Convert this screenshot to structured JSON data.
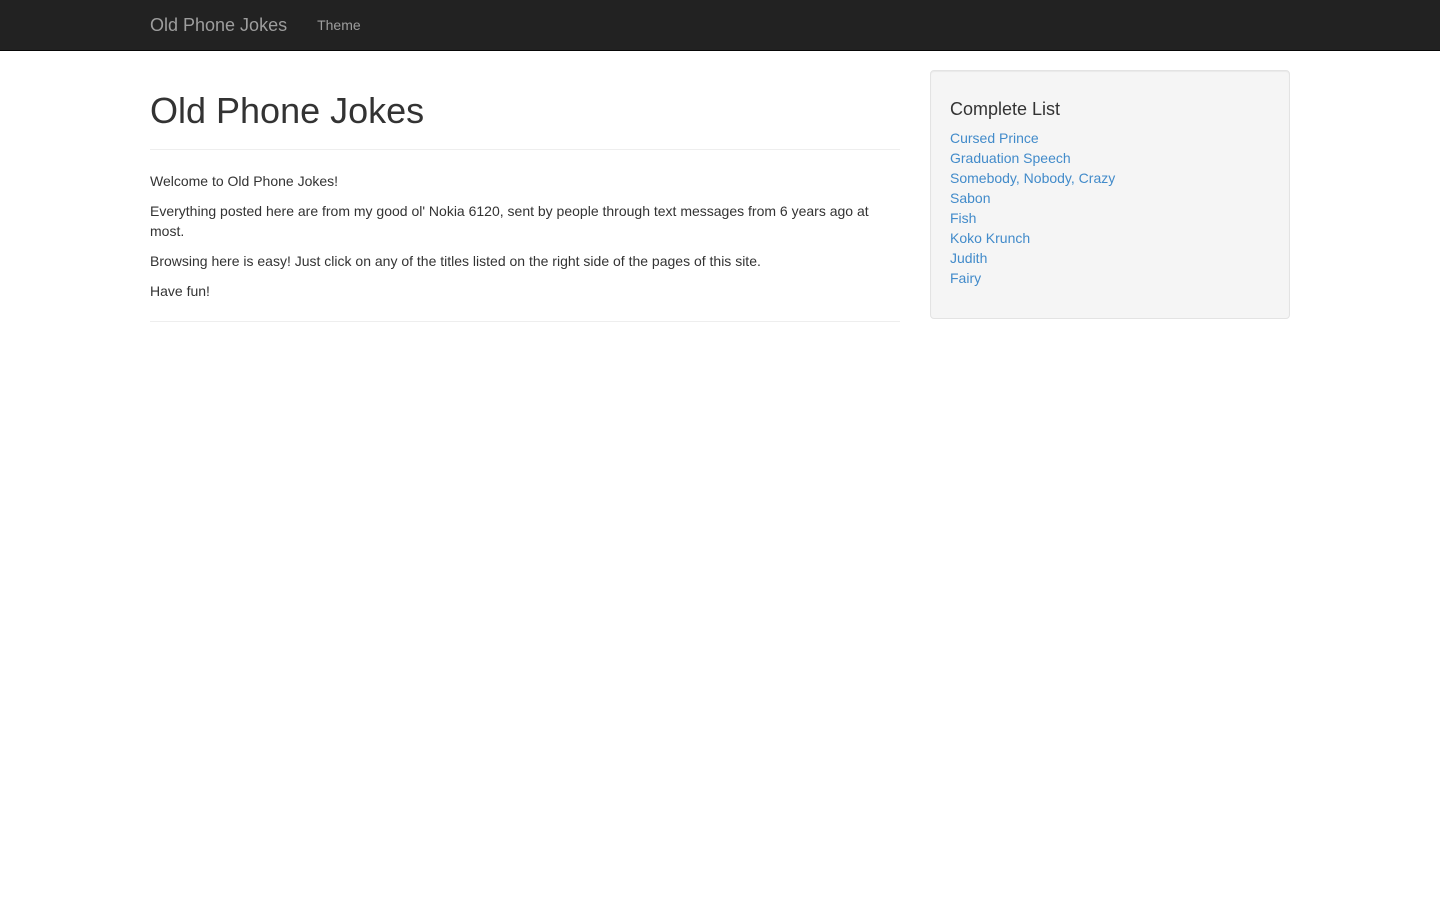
{
  "navbar": {
    "brand": "Old Phone Jokes",
    "links": [
      {
        "label": "Theme"
      }
    ]
  },
  "main": {
    "title": "Old Phone Jokes",
    "paragraphs": [
      "Welcome to Old Phone Jokes!",
      "Everything posted here are from my good ol' Nokia 6120, sent by people through text messages from 6 years ago at most.",
      "Browsing here is easy! Just click on any of the titles listed on the right side of the pages of this site.",
      "Have fun!"
    ]
  },
  "sidebar": {
    "title": "Complete List",
    "items": [
      {
        "label": "Cursed Prince"
      },
      {
        "label": "Graduation Speech"
      },
      {
        "label": "Somebody, Nobody, Crazy"
      },
      {
        "label": "Sabon"
      },
      {
        "label": "Fish"
      },
      {
        "label": "Koko Krunch"
      },
      {
        "label": "Judith"
      },
      {
        "label": "Fairy"
      }
    ]
  },
  "colors": {
    "navbar_bg": "#222222",
    "navbar_text": "#9d9d9d",
    "link": "#428bca",
    "well_bg": "#f5f5f5"
  }
}
